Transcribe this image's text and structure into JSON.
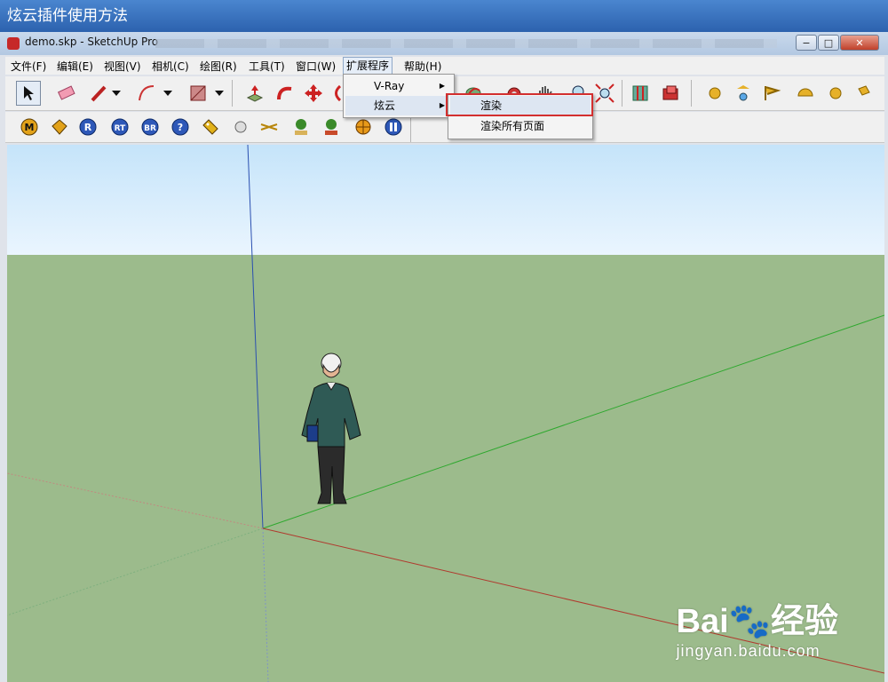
{
  "banner": {
    "title": "炫云插件使用方法"
  },
  "window": {
    "title": "demo.skp - SketchUp Pro",
    "minimize": "−",
    "maximize": "□",
    "close": "✕"
  },
  "menubar": {
    "items": [
      "文件(F)",
      "编辑(E)",
      "视图(V)",
      "相机(C)",
      "绘图(R)",
      "工具(T)",
      "窗口(W)",
      "扩展程序",
      "帮助(H)"
    ],
    "active_index": 7
  },
  "dropdown_extensions": {
    "items": [
      "V-Ray",
      "炫云"
    ],
    "hover_index": 1
  },
  "submenu_xuanyun": {
    "items": [
      "渲染",
      "渲染所有页面"
    ],
    "highlighted_index": 0
  },
  "toolbar2_labels": [
    "M",
    "R",
    "RT",
    "BR",
    "?"
  ],
  "watermark": {
    "brand": "Bai",
    "brand2": "经验",
    "url": "jingyan.baidu.com"
  },
  "colors": {
    "highlight_box": "#d32f2f",
    "sky": "#c5e4fa",
    "ground": "#9cbb8c",
    "axis_red": "#b03a2e",
    "axis_green": "#2ea82e",
    "axis_blue": "#2a4fb0"
  }
}
